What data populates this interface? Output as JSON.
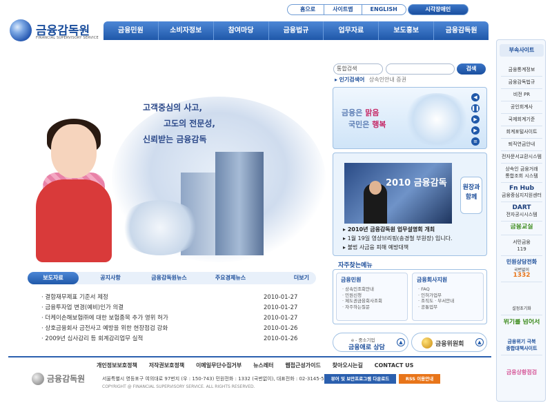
{
  "top_links": [
    "홈으로",
    "사이트맵",
    "ENGLISH"
  ],
  "visual_button": "시각장애인",
  "logo": {
    "name": "금융감독원",
    "subtitle": "FINANCIAL SUPERVISORY SERVICE"
  },
  "main_nav": [
    "금융민원",
    "소비자정보",
    "참여마당",
    "금융법규",
    "업무자료",
    "보도홍보",
    "금융감독원"
  ],
  "sidebar": {
    "title": "부속사이트",
    "items": [
      "금융통계정보",
      "금융감독법규",
      "비전 PR",
      "공인회계사",
      "국제회계기준",
      "회계포털사이트",
      "퇴직연금안내",
      "전자문서교환시스템",
      "상속인 금융거래",
      "통합조회 시스템",
      "Fn Hub",
      "금융중심지지원센터",
      "DART",
      "전자공시시스템",
      "금융교실",
      "서민금융",
      "119",
      "민원상담전화",
      "국번없이",
      "1332",
      "설정초기화",
      "위기를 넘어서",
      "금융위기 극복",
      "종합대책사이트",
      "금융상황점검"
    ]
  },
  "hero": {
    "slogan": [
      "고객중심의 사고,",
      "고도의 전문성,",
      "신뢰받는 금융감독"
    ]
  },
  "news": {
    "tabs": [
      "보도자료",
      "공지사항",
      "금융감독원뉴스",
      "주요경제뉴스"
    ],
    "more": "더보기",
    "items": [
      {
        "title": "결합재무제표 기준서 제정",
        "date": "2010-01-27"
      },
      {
        "title": "금융투자업 변경(예비)인가 의결",
        "date": "2010-01-27"
      },
      {
        "title": "더케이손해보험㈜에 대한 보험종목 추가 영위 허가",
        "date": "2010-01-27"
      },
      {
        "title": "상호금융회사 금전사고 예방을 위한 현장점검 강화",
        "date": "2010-01-26"
      },
      {
        "title": "2009년 심사감리 등 회계감리업무 실적",
        "date": "2010-01-26"
      }
    ]
  },
  "search": {
    "select": "통합검색",
    "button": "검색",
    "popular_label": "인기검색어",
    "popular_value": "상속인안내 증권"
  },
  "banner": {
    "line1a": "금융은 ",
    "line1b": "맑음",
    "line2a": "국민은 ",
    "line2b": "행복"
  },
  "photo_news": {
    "photo_title": "2010 금융감독",
    "side_button": [
      "원장과",
      "함께"
    ],
    "items": [
      "2010년 금융감독원 업무설명회 개최",
      "1월 19일 영상브리핑(송경철 부원장) 입니다.",
      "불법 사금융 피해 예방대책"
    ]
  },
  "quick_menu": {
    "title": "자주찾는메뉴",
    "col1": {
      "title": "금융민원",
      "items": [
        "상속인조회안내",
        "민원신청",
        "제도권금융회사조회",
        "자주하는질문"
      ]
    },
    "col2": {
      "title": "금융회사지원",
      "items": [
        "FAQ",
        "인허가업무",
        "조직도 · 부서안내",
        "공통업무"
      ]
    }
  },
  "bottom_buttons": {
    "consult_small": "e - 중소기업",
    "consult_big": "금융애로 상담",
    "commission": "금융위원회"
  },
  "footer": {
    "links": [
      "개인정보보호정책",
      "저작권보호정책",
      "이메일무단수집거부",
      "뉴스레터",
      "웹접근성가이드",
      "찾아오시는길",
      "CONTACT US"
    ],
    "logo": "금융감독원",
    "address": "서울특별시 영등포구 여의대로 97번지 (우 : 150-743)   민원전화 : 1332 (국번없이),  대표전화 : 02-3145-5114",
    "copyright": "COPYRIGHT @ FINANCIAL SUPERVISORY SERVICE. ALL RIGHTS RESERVED.",
    "download": "뷰어 및 보안프로그램 다운로드",
    "rss": "RSS 이용안내"
  },
  "colors": {
    "primary": "#1f58a9",
    "accent": "#c22222",
    "rss": "#e8751a"
  }
}
